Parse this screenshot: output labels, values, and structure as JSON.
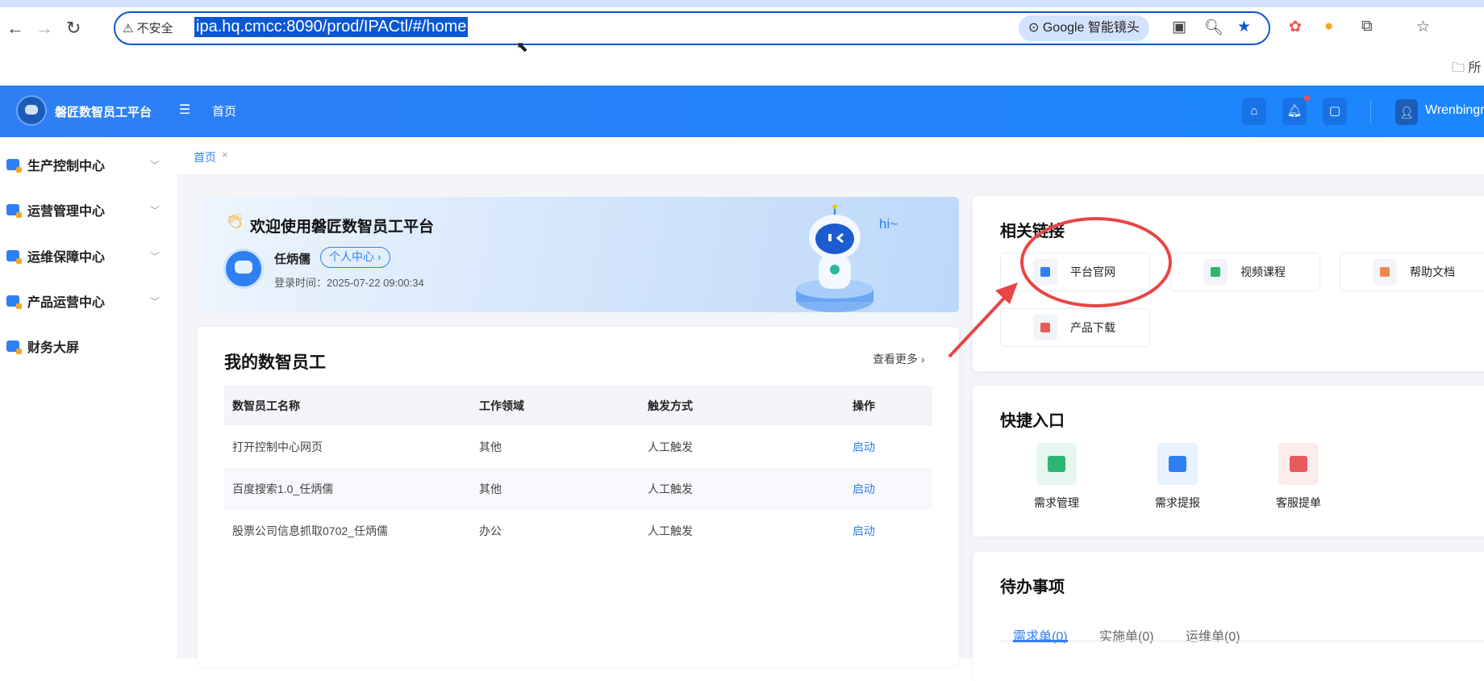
{
  "browser": {
    "insecure_label": "不安全",
    "url": "ipa.hq.cmcc:8090/prod/IPACtl/#/home",
    "lens_label": "Google 智能镜头",
    "bookmark_partial": "所"
  },
  "header": {
    "app_title": "磐匠数智员工平台",
    "nav_home": "首页",
    "username": "Wrenbingru"
  },
  "sidebar": {
    "items": [
      {
        "label": "生产控制中心",
        "expandable": true
      },
      {
        "label": "运营管理中心",
        "expandable": true
      },
      {
        "label": "运维保障中心",
        "expandable": true
      },
      {
        "label": "产品运营中心",
        "expandable": true
      },
      {
        "label": "财务大屏",
        "expandable": false
      }
    ]
  },
  "tabs": {
    "home": "首页",
    "close": "×"
  },
  "welcome": {
    "title": "欢迎使用磐匠数智员工平台",
    "user_name": "任炳儒",
    "personal_center": "个人中心",
    "login_time": "登录时间：2025-07-22 09:00:34",
    "greeting": "hi~"
  },
  "employees": {
    "title": "我的数智员工",
    "more": "查看更多",
    "columns": [
      "数智员工名称",
      "工作领域",
      "触发方式",
      "操作"
    ],
    "rows": [
      [
        "打开控制中心网页",
        "其他",
        "人工触发",
        "启动"
      ],
      [
        "百度搜索1.0_任炳儒",
        "其他",
        "人工触发",
        "启动"
      ],
      [
        "股票公司信息抓取0702_任炳儒",
        "办公",
        "人工触发",
        "启动"
      ]
    ]
  },
  "links": {
    "title": "相关链接",
    "items": [
      {
        "label": "平台官网",
        "color": "#2f7ff4"
      },
      {
        "label": "视频课程",
        "color": "#2bb673"
      },
      {
        "label": "帮助文档",
        "color": "#f08a4b"
      },
      {
        "label": "产品下载",
        "color": "#e85b5b"
      }
    ]
  },
  "quick": {
    "title": "快捷入口",
    "items": [
      {
        "label": "需求管理",
        "color": "#2bb673",
        "bg": "#e6f7ef"
      },
      {
        "label": "需求提报",
        "color": "#2f7ff4",
        "bg": "#e8f2ff"
      },
      {
        "label": "客服提单",
        "color": "#e85b5b",
        "bg": "#fdecec"
      }
    ]
  },
  "todo": {
    "title": "待办事项",
    "tabs": [
      "需求单(0)",
      "实施单(0)",
      "运维单(0)"
    ],
    "active_tab": 0
  },
  "colors": {
    "primary": "#2f7ff4",
    "annotation": "#e84545"
  }
}
